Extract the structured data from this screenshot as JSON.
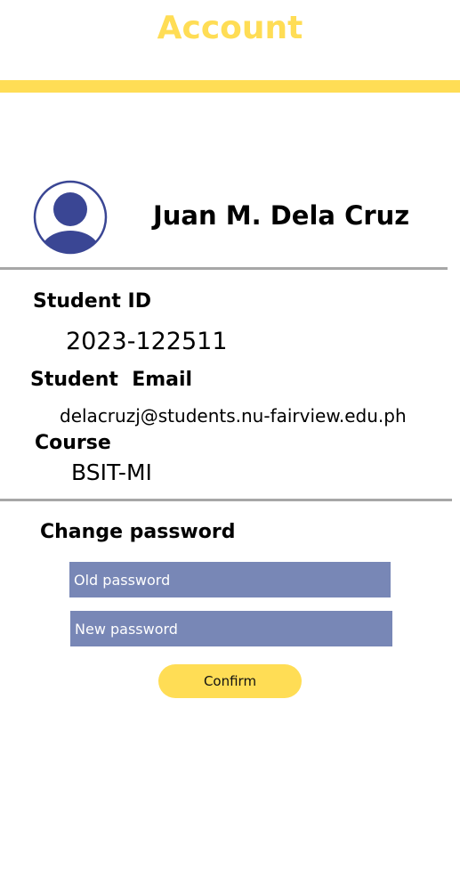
{
  "header": {
    "title": "Account"
  },
  "profile": {
    "avatar_icon": "user-avatar-icon",
    "name": "Juan M. Dela Cruz"
  },
  "details": {
    "student_id_label": "Student ID",
    "student_id_value": "2023-122511",
    "student_email_label": "Student  Email",
    "student_email_value": "delacruzj@students.nu-fairview.edu.ph",
    "course_label": "Course",
    "course_value": "BSIT-MI"
  },
  "change_password": {
    "heading": "Change password",
    "old_password_placeholder": "Old password",
    "new_password_placeholder": "New password",
    "confirm_label": "Confirm"
  },
  "colors": {
    "accent_yellow": "#FFDD55",
    "input_blue": "#7887B6",
    "avatar_navy": "#3A4694",
    "divider_gray": "#A7A7A7"
  }
}
